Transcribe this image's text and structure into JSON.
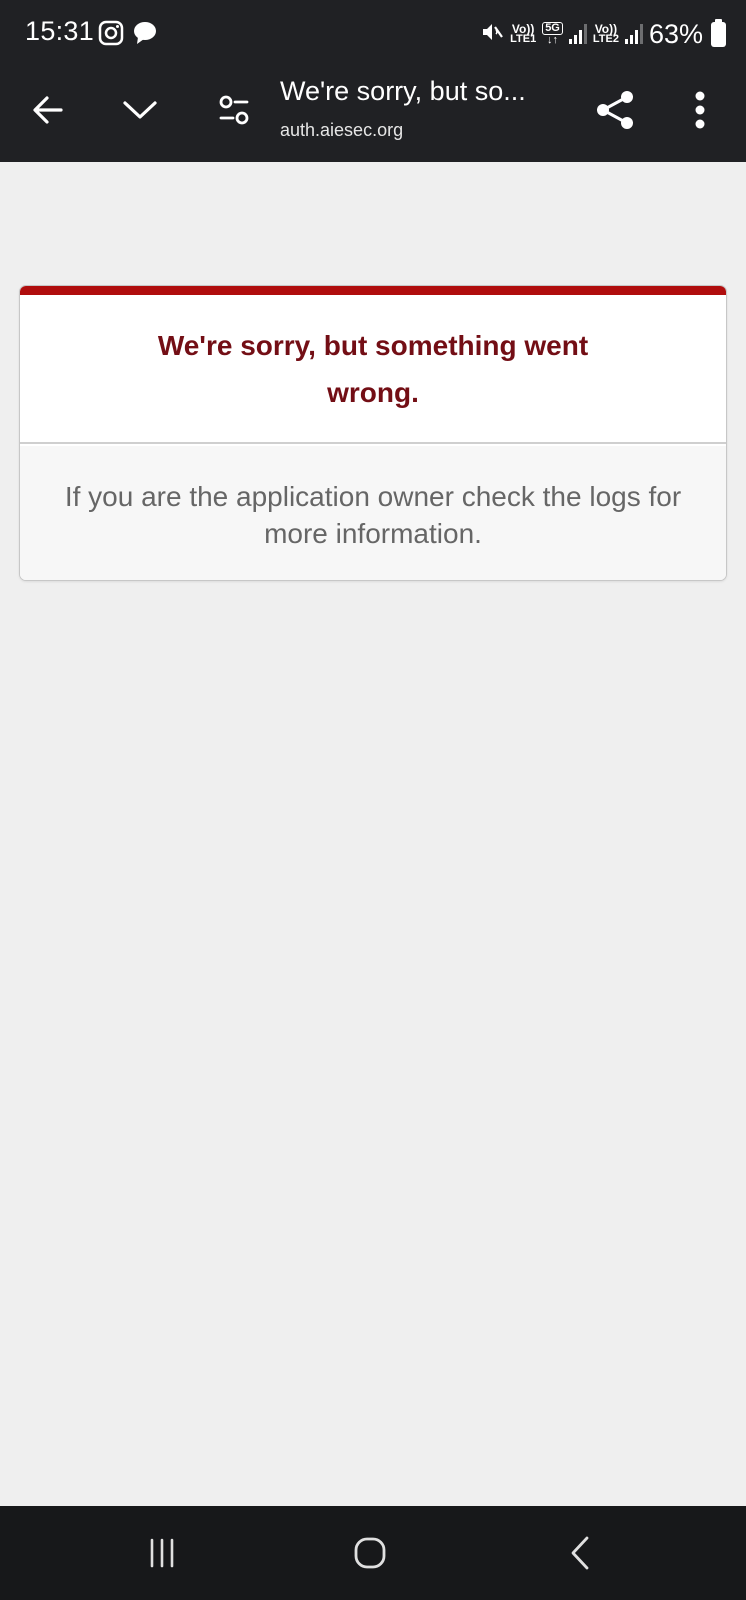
{
  "status_bar": {
    "time": "15:31",
    "icons_left": [
      "instagram-icon",
      "chat-bubble-icon"
    ],
    "sim1_top": "Vo))",
    "sim1_bottom": "LTE1",
    "network_type": "5G",
    "sim2_top": "Vo))",
    "sim2_bottom": "LTE2",
    "battery_percent": "63%",
    "battery_level": 0.63
  },
  "toolbar": {
    "title": "We're sorry, but so...",
    "url": "auth.aiesec.org",
    "icons": [
      "back-arrow-icon",
      "chevron-down-icon",
      "tune-icon",
      "share-icon",
      "more-vert-icon"
    ]
  },
  "error_card": {
    "heading": "We're sorry, but something went wrong.",
    "message": "If you are the application owner check the logs for more information.",
    "accent_color": "#b00d0d",
    "heading_color": "#730e15"
  },
  "nav_bar": {
    "icons": [
      "recents-icon",
      "home-icon",
      "back-icon"
    ]
  }
}
